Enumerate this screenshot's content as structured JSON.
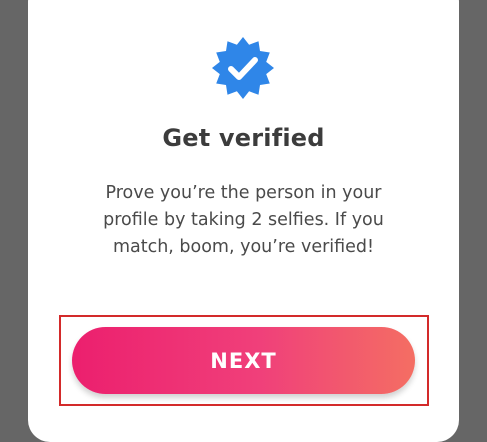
{
  "dialog": {
    "title": "Get verified",
    "description_lines": [
      "Prove you’re the person in your",
      "profile by taking 2 selfies. If you",
      "match, boom, you’re verified!"
    ],
    "next_label": "NEXT",
    "badge_icon": "verified-badge-icon"
  },
  "colors": {
    "badge_blue": "#2f86e8",
    "gradient_start": "#ec1f6e",
    "gradient_end": "#f46e63",
    "highlight": "#d32a2a",
    "overlay": "#666666"
  }
}
